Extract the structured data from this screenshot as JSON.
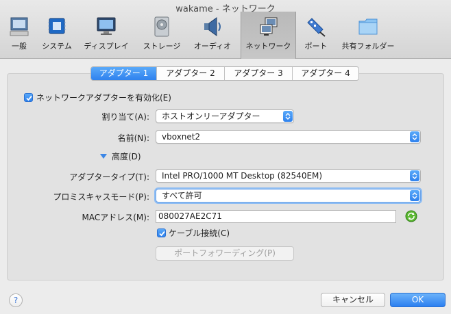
{
  "window": {
    "title": "wakame - ネットワーク"
  },
  "toolbar": {
    "items": [
      {
        "label": "一般",
        "icon": "general-icon"
      },
      {
        "label": "システム",
        "icon": "system-icon"
      },
      {
        "label": "ディスプレイ",
        "icon": "display-icon"
      },
      {
        "label": "ストレージ",
        "icon": "storage-icon"
      },
      {
        "label": "オーディオ",
        "icon": "audio-icon"
      },
      {
        "label": "ネットワーク",
        "icon": "network-icon",
        "selected": true
      },
      {
        "label": "ポート",
        "icon": "port-icon"
      },
      {
        "label": "共有フォルダー",
        "icon": "shared-folder-icon"
      }
    ]
  },
  "tabs": [
    {
      "label": "アダプター 1",
      "active": true
    },
    {
      "label": "アダプター 2"
    },
    {
      "label": "アダプター 3"
    },
    {
      "label": "アダプター 4"
    }
  ],
  "form": {
    "enable_label": "ネットワークアダプターを有効化(E)",
    "enable_checked": true,
    "attached_label": "割り当て(A):",
    "attached_value": "ホストオンリーアダプター",
    "name_label": "名前(N):",
    "name_value": "vboxnet2",
    "advanced_label": "高度(D)",
    "adapter_type_label": "アダプタータイプ(T):",
    "adapter_type_value": "Intel PRO/1000 MT Desktop (82540EM)",
    "promisc_label": "プロミスキャスモード(P):",
    "promisc_value": "すべて許可",
    "mac_label": "MACアドレス(M):",
    "mac_value": "080027AE2C71",
    "cable_label": "ケーブル接続(C)",
    "cable_checked": true,
    "port_forward_label": "ポートフォワーディング(P)"
  },
  "footer": {
    "help": "?",
    "cancel_label": "キャンセル",
    "ok_label": "OK"
  },
  "colors": {
    "accent": "#2f82ee"
  }
}
